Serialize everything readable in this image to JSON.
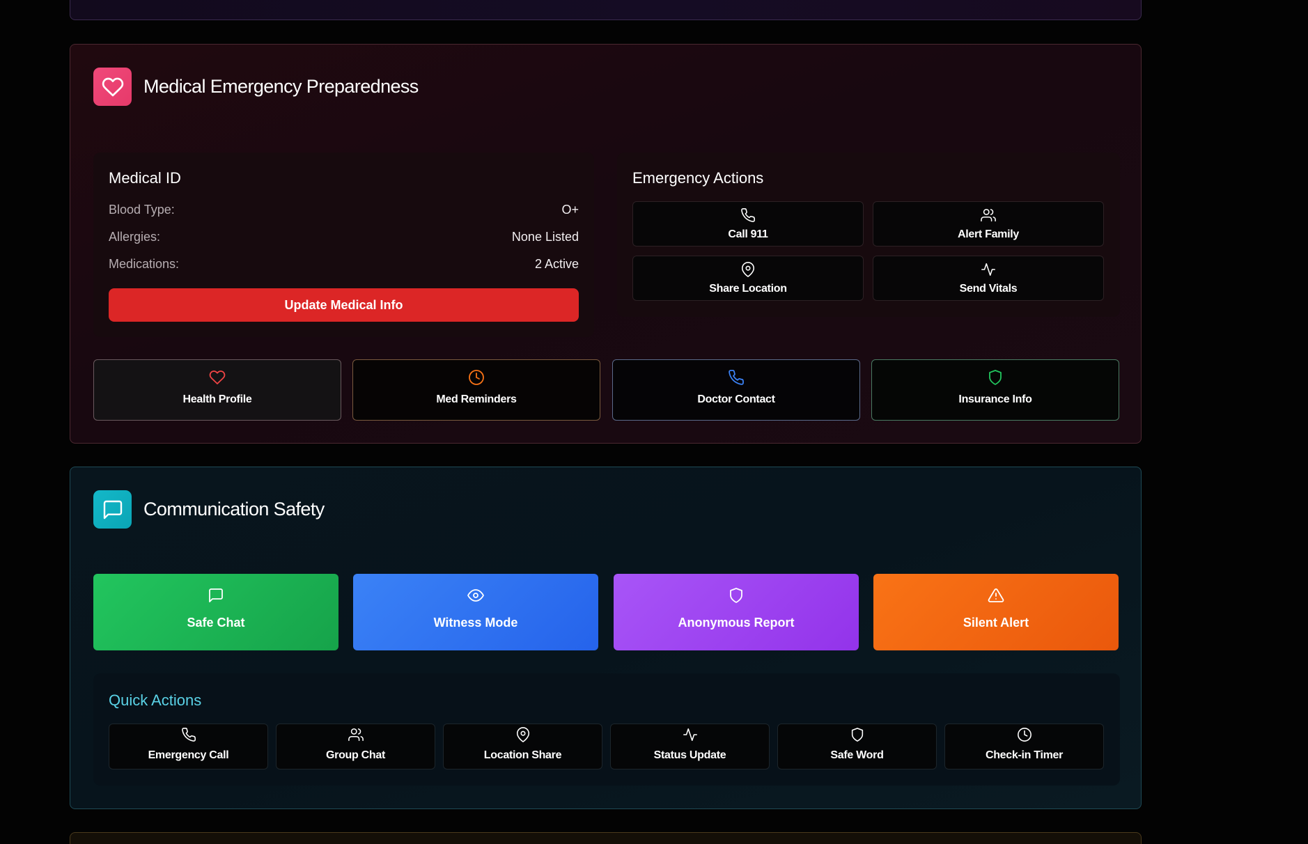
{
  "medical": {
    "title": "Medical Emergency Preparedness",
    "medical_id": {
      "title": "Medical ID",
      "fields": [
        {
          "label": "Blood Type:",
          "value": "O+"
        },
        {
          "label": "Allergies:",
          "value": "None Listed"
        },
        {
          "label": "Medications:",
          "value": "2 Active"
        }
      ],
      "update_button": "Update Medical Info"
    },
    "emergency_actions": {
      "title": "Emergency Actions",
      "buttons": [
        {
          "label": "Call 911",
          "icon": "phone-icon"
        },
        {
          "label": "Alert Family",
          "icon": "users-icon"
        },
        {
          "label": "Share Location",
          "icon": "map-pin-icon"
        },
        {
          "label": "Send Vitals",
          "icon": "activity-icon"
        }
      ]
    },
    "tiles": [
      {
        "label": "Health Profile",
        "icon": "heart-icon",
        "color": "#ef4444"
      },
      {
        "label": "Med Reminders",
        "icon": "clock-icon",
        "color": "#f97316"
      },
      {
        "label": "Doctor Contact",
        "icon": "phone-icon",
        "color": "#3b82f6"
      },
      {
        "label": "Insurance Info",
        "icon": "shield-icon",
        "color": "#22c55e"
      }
    ]
  },
  "communication": {
    "title": "Communication Safety",
    "big_buttons": [
      {
        "label": "Safe Chat",
        "icon": "message-icon",
        "color": "#22c55e"
      },
      {
        "label": "Witness Mode",
        "icon": "eye-icon",
        "color": "#3b82f6"
      },
      {
        "label": "Anonymous Report",
        "icon": "shield-icon",
        "color": "#a855f7"
      },
      {
        "label": "Silent Alert",
        "icon": "alert-triangle-icon",
        "color": "#f97316"
      }
    ],
    "quick_actions": {
      "title": "Quick Actions",
      "buttons": [
        {
          "label": "Emergency Call",
          "icon": "phone-icon"
        },
        {
          "label": "Group Chat",
          "icon": "users-icon"
        },
        {
          "label": "Location Share",
          "icon": "map-pin-icon"
        },
        {
          "label": "Status Update",
          "icon": "activity-icon"
        },
        {
          "label": "Safe Word",
          "icon": "shield-icon"
        },
        {
          "label": "Check-in Timer",
          "icon": "clock-icon"
        }
      ]
    }
  }
}
